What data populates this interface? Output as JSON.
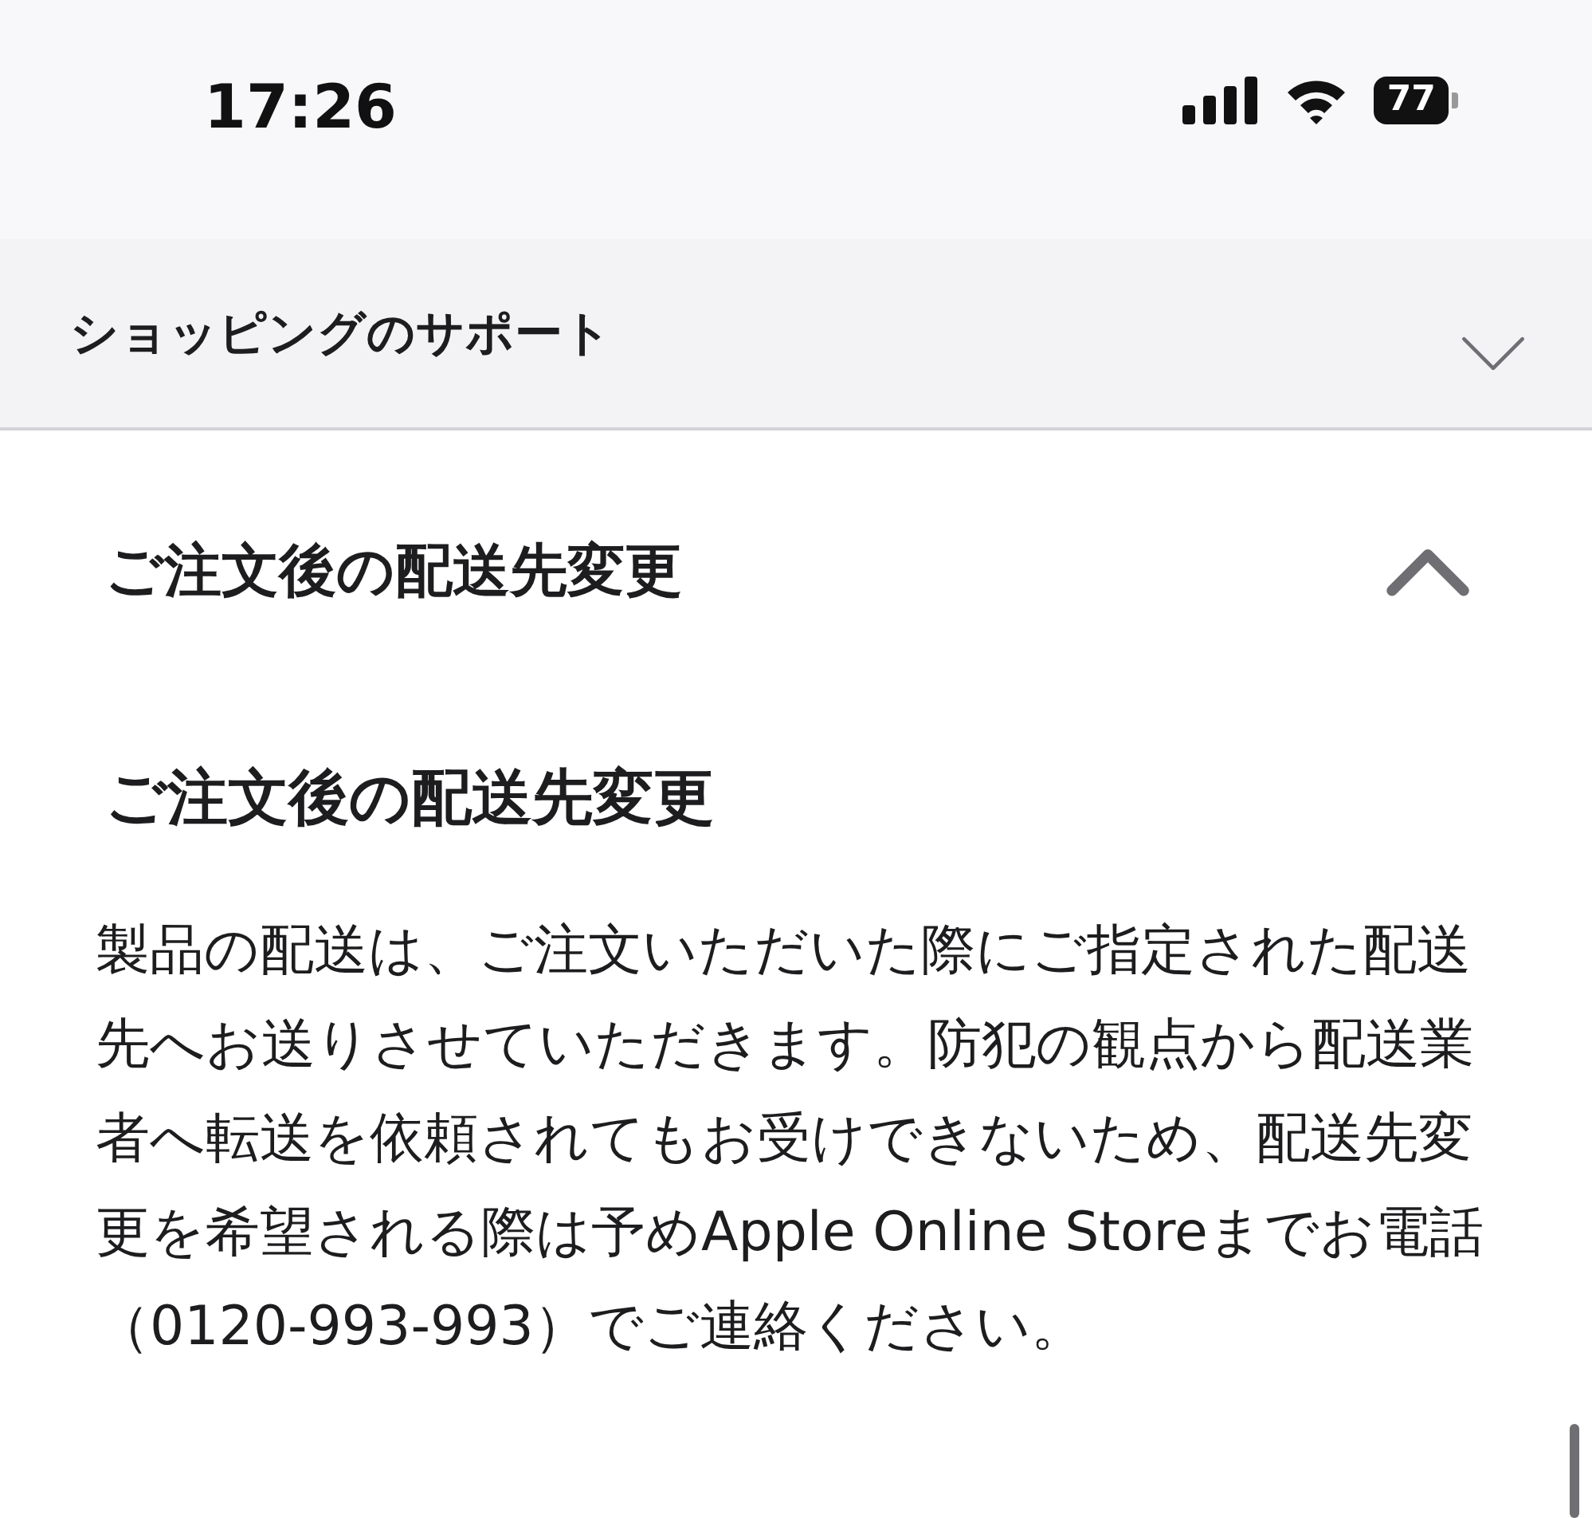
{
  "status_bar": {
    "time": "17:26",
    "battery": "77"
  },
  "menu": {
    "title": "ショッピングのサポート",
    "expanded": false
  },
  "accordion": {
    "title": "ご注文後の配送先変更",
    "expanded": true
  },
  "article": {
    "heading": "ご注文後の配送先変更",
    "body": "製品の配送は、ご注文いただいた際にご指定された配送先へお送りさせていただきます。防犯の観点から配送業者へ転送を依頼されてもお受けできないため、配送先変更を希望される際は予めApple Online Storeまでお電話（0120-993-993）でご連絡ください。"
  }
}
